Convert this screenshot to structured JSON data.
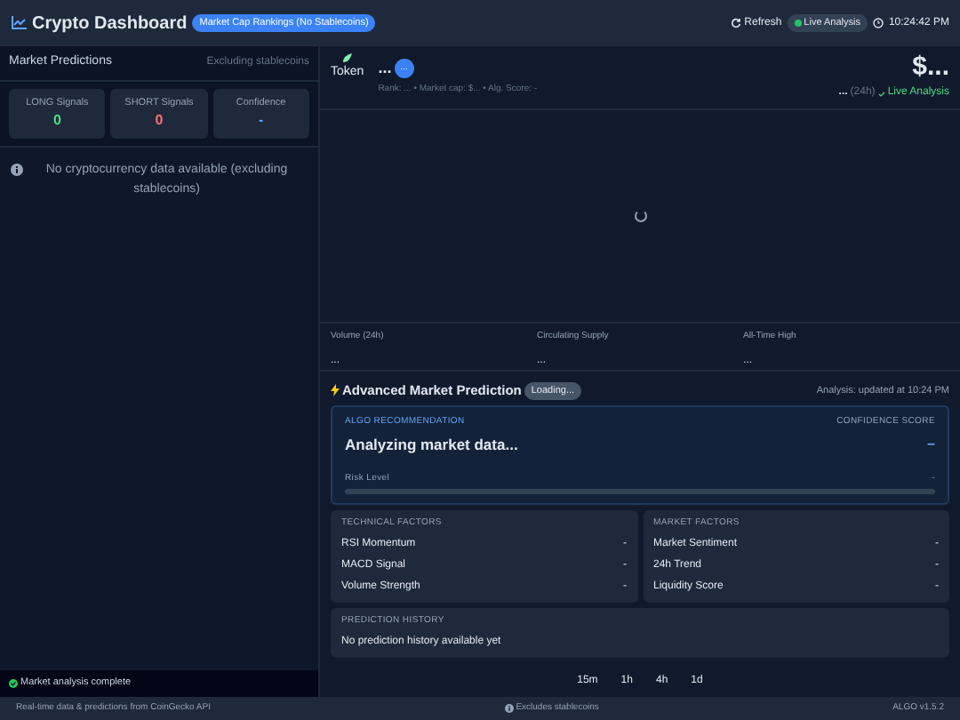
{
  "header": {
    "title": "Crypto Dashboard",
    "badge": "Market Cap Rankings (No Stablecoins)",
    "refresh": "Refresh",
    "live": "Live Analysis",
    "time": "10:24:42 PM"
  },
  "sidebar": {
    "title": "Market Predictions",
    "subtitle": "Excluding stablecoins",
    "stats": [
      {
        "label": "LONG Signals",
        "value": "0",
        "kind": "long"
      },
      {
        "label": "SHORT Signals",
        "value": "0",
        "kind": "short"
      },
      {
        "label": "Confidence",
        "value": "-",
        "kind": "neutral"
      }
    ],
    "empty_message": "No cryptocurrency data available (excluding stablecoins)",
    "status": "Market analysis complete"
  },
  "token": {
    "label": "Token",
    "name": "...",
    "badge": "...",
    "meta": "Rank: ... • Market cap: $... • Alg. Score: -",
    "price": "$...",
    "change": "...",
    "period": "(24h)",
    "live": "Live Analysis"
  },
  "metrics": [
    {
      "label": "Volume (24h)",
      "value": "..."
    },
    {
      "label": "Circulating Supply",
      "value": "..."
    },
    {
      "label": "All-Time High",
      "value": "..."
    }
  ],
  "prediction": {
    "title": "Advanced Market Prediction",
    "badge": "Loading...",
    "updated": "Analysis: updated at 10:24 PM",
    "recommendation_label": "ALGO RECOMMENDATION",
    "recommendation": "Analyzing market data...",
    "confidence_label": "CONFIDENCE SCORE",
    "confidence": "–",
    "risk_label": "Risk Level",
    "risk_value": "-",
    "risk": {
      "level": 0
    },
    "factor_groups": [
      {
        "title": "TECHNICAL FACTORS",
        "items": [
          {
            "label": "RSI Momentum",
            "value": "-"
          },
          {
            "label": "MACD Signal",
            "value": "-"
          },
          {
            "label": "Volume Strength",
            "value": "-"
          }
        ]
      },
      {
        "title": "MARKET FACTORS",
        "items": [
          {
            "label": "Market Sentiment",
            "value": "-"
          },
          {
            "label": "24h Trend",
            "value": "-"
          },
          {
            "label": "Liquidity Score",
            "value": "-"
          }
        ]
      }
    ],
    "history_title": "PREDICTION HISTORY",
    "history_empty": "No prediction history available yet"
  },
  "timeframes": [
    "15m",
    "1h",
    "4h",
    "1d"
  ],
  "footer": {
    "source": "Real-time data & predictions from CoinGecko API",
    "note": "Excludes stablecoins",
    "version": "ALGO v1.5.2"
  }
}
